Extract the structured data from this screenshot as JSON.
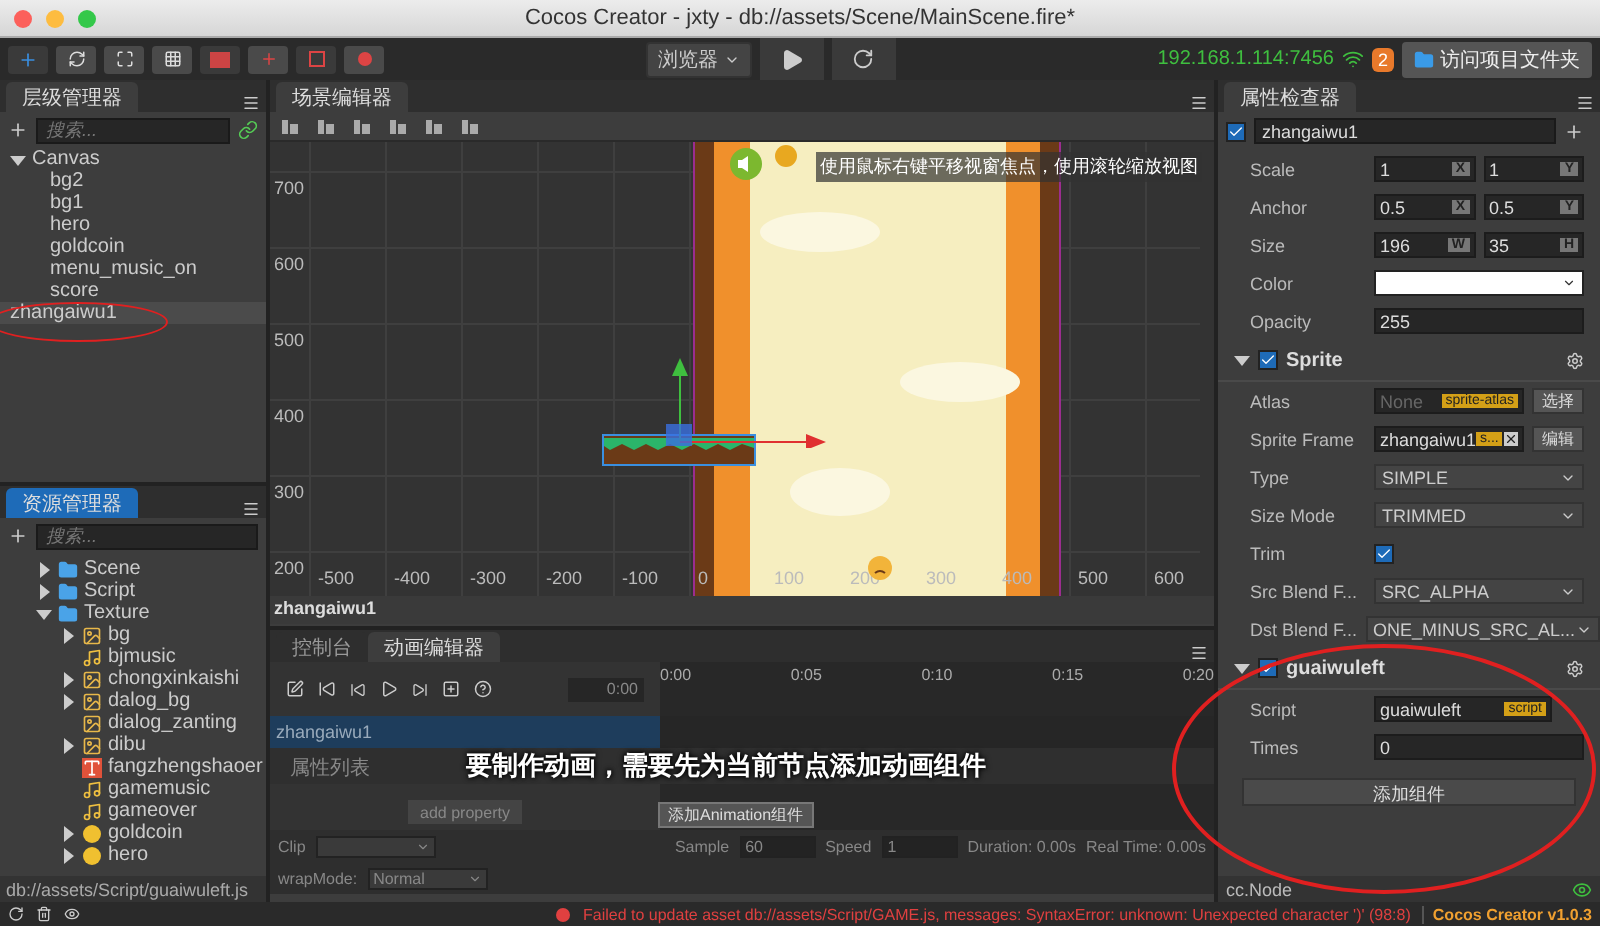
{
  "window": {
    "title": "Cocos Creator - jxty - db://assets/Scene/MainScene.fire*"
  },
  "toolbar": {
    "preview_dropdown": "浏览器",
    "ip": "192.168.1.114:7456",
    "notification_count": "2",
    "open_folder_button": "访问项目文件夹"
  },
  "hierarchy": {
    "title": "层级管理器",
    "search_placeholder": "搜索...",
    "tree": [
      {
        "label": "Canvas",
        "selected": false,
        "expanded": true,
        "children": [
          {
            "label": "bg2",
            "selected": false
          },
          {
            "label": "bg1",
            "selected": false
          },
          {
            "label": "hero",
            "selected": false
          },
          {
            "label": "goldcoin",
            "selected": false
          },
          {
            "label": "menu_music_on",
            "selected": false
          },
          {
            "label": "score",
            "selected": false
          }
        ]
      },
      {
        "label": "zhangaiwu1",
        "selected": true
      }
    ]
  },
  "assets": {
    "title": "资源管理器",
    "search_placeholder": "搜索...",
    "tree": [
      {
        "label": "Scene",
        "kind": "folder",
        "expandable": true,
        "expanded": false
      },
      {
        "label": "Script",
        "kind": "folder",
        "expandable": true,
        "expanded": false
      },
      {
        "label": "Texture",
        "kind": "folder",
        "expandable": true,
        "expanded": true,
        "children": [
          {
            "label": "bg",
            "kind": "image",
            "expandable": true,
            "expanded": false
          },
          {
            "label": "bjmusic",
            "kind": "audio",
            "expandable": false
          },
          {
            "label": "chongxinkaishi",
            "kind": "image",
            "expandable": true,
            "expanded": false
          },
          {
            "label": "dalog_bg",
            "kind": "image",
            "expandable": true,
            "expanded": false
          },
          {
            "label": "dialog_zanting",
            "kind": "image",
            "expandable": false
          },
          {
            "label": "dibu",
            "kind": "image",
            "expandable": true,
            "expanded": false
          },
          {
            "label": "fangzhengshaoer",
            "kind": "font",
            "expandable": false
          },
          {
            "label": "gamemusic",
            "kind": "audio",
            "expandable": false
          },
          {
            "label": "gameover",
            "kind": "audio",
            "expandable": false
          },
          {
            "label": "goldcoin",
            "kind": "round",
            "expandable": true,
            "expanded": false
          },
          {
            "label": "hero",
            "kind": "round",
            "expandable": true,
            "expanded": false
          }
        ]
      }
    ],
    "path": "db://assets/Script/guaiwuleft.js"
  },
  "scene": {
    "title": "场景编辑器",
    "hint": "使用鼠标右键平移视窗焦点，使用滚轮缩放视图",
    "y_ticks": [
      "700",
      "600",
      "500",
      "400",
      "300",
      "200"
    ],
    "x_ticks": [
      "-500",
      "-400",
      "-300",
      "-200",
      "-100",
      "0",
      "100",
      "200",
      "300",
      "400",
      "500",
      "600"
    ],
    "selected_node": "zhangaiwu1"
  },
  "animation": {
    "tabs": [
      {
        "label": "控制台",
        "selected": false
      },
      {
        "label": "动画编辑器",
        "selected": true
      }
    ],
    "time": "0:00",
    "timeline": [
      "0:00",
      "0:05",
      "0:10",
      "0:15",
      "0:20"
    ],
    "node": "zhangaiwu1",
    "properties_label": "属性列表",
    "add_property": "add property",
    "message": "要制作动画，需要先为当前节点添加动画组件",
    "add_button": "添加Animation组件",
    "clip_label": "Clip",
    "sample_label": "Sample",
    "sample": "60",
    "speed_label": "Speed",
    "speed": "1",
    "duration": "Duration: 0.00s",
    "real_time": "Real Time: 0.00s",
    "wrap_label": "wrapMode:",
    "wrap_mode": "Normal"
  },
  "inspector": {
    "title": "属性检查器",
    "node": {
      "name": "zhangaiwu1",
      "active": true
    },
    "properties": [
      {
        "label": "Scale",
        "kind": "vector",
        "values": [
          {
            "value": "1",
            "axis": "X"
          },
          {
            "value": "1",
            "axis": "Y"
          }
        ]
      },
      {
        "label": "Anchor",
        "kind": "vector",
        "values": [
          {
            "value": "0.5",
            "axis": "X"
          },
          {
            "value": "0.5",
            "axis": "Y"
          }
        ]
      },
      {
        "label": "Size",
        "kind": "vector",
        "values": [
          {
            "value": "196",
            "axis": "W"
          },
          {
            "value": "35",
            "axis": "H"
          }
        ]
      },
      {
        "label": "Color",
        "kind": "color",
        "color": "#ffffff"
      },
      {
        "label": "Opacity",
        "kind": "number",
        "value": "255"
      }
    ],
    "components": [
      {
        "name": "Sprite",
        "enabled": true,
        "expanded": true,
        "rows": [
          {
            "label": "Atlas",
            "kind": "asset",
            "placeholder": "None",
            "tag": "sprite-atlas",
            "button": "选择"
          },
          {
            "label": "Sprite Frame",
            "kind": "asset",
            "value": "zhangaiwu1",
            "tag": "s...",
            "button": "编辑"
          },
          {
            "label": "Type",
            "kind": "select",
            "value": "SIMPLE"
          },
          {
            "label": "Size Mode",
            "kind": "select",
            "value": "TRIMMED"
          },
          {
            "label": "Trim",
            "kind": "checkbox",
            "checked": true
          },
          {
            "label": "Src Blend F...",
            "kind": "select",
            "value": "SRC_ALPHA"
          },
          {
            "label": "Dst Blend F...",
            "kind": "select",
            "value": "ONE_MINUS_SRC_AL..."
          }
        ]
      },
      {
        "name": "guaiwuleft",
        "enabled": true,
        "expanded": true,
        "rows": [
          {
            "label": "Script",
            "kind": "script",
            "value": "guaiwuleft",
            "tag": "script"
          },
          {
            "label": "Times",
            "kind": "number",
            "value": "0"
          }
        ]
      }
    ],
    "add_component": "添加组件",
    "footer": "cc.Node"
  },
  "status_bar": {
    "error": "Failed to update asset db://assets/Script/GAME.js, messages: SyntaxError: unknown: Unexpected character ')'  (98:8)",
    "version": "Cocos Creator v1.0.3"
  }
}
